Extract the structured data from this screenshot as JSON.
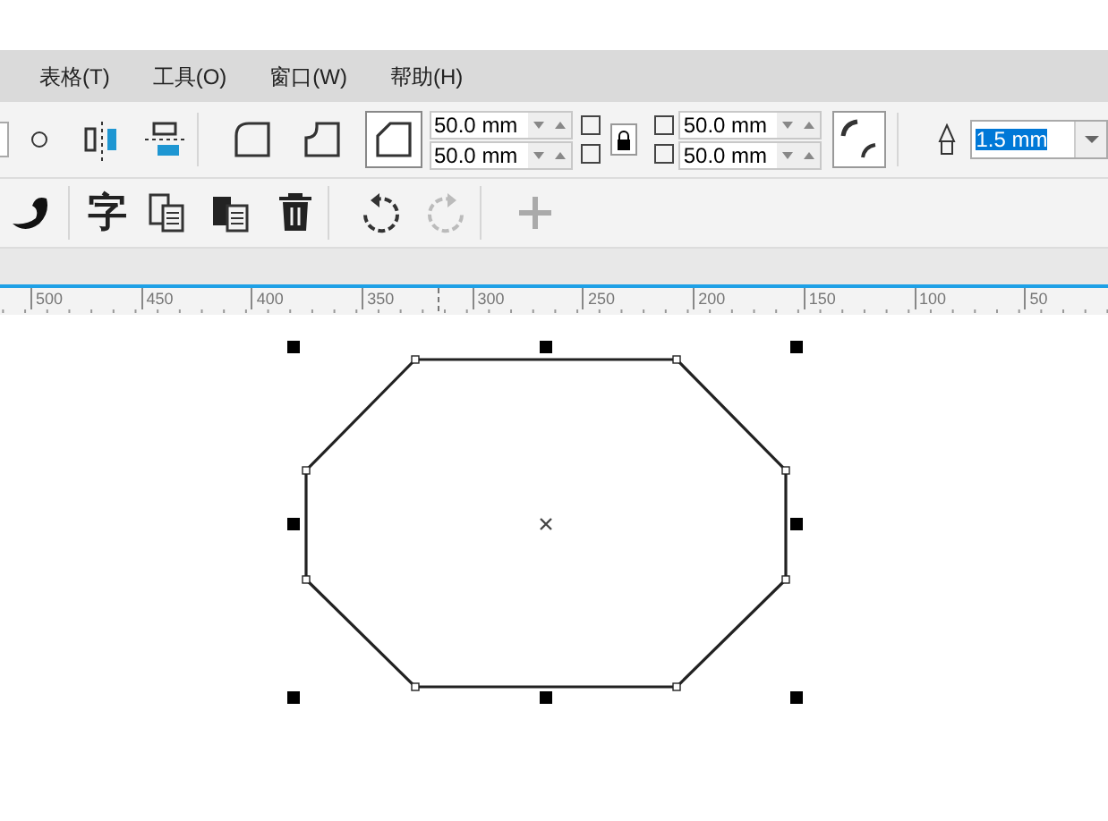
{
  "menu": [
    "表格(T)",
    "工具(O)",
    "窗口(W)",
    "帮助(H)"
  ],
  "corner_buttons": [
    {
      "kind": "round",
      "selected": false
    },
    {
      "kind": "scallop",
      "selected": false
    },
    {
      "kind": "chamfer",
      "selected": true
    }
  ],
  "corner_fields_left": [
    "50.0 mm",
    "50.0 mm"
  ],
  "corner_fields_right": [
    "50.0 mm",
    "50.0 mm"
  ],
  "outline_width": {
    "value": "1.5 mm",
    "highlighted": true
  },
  "text_tool_label": "字",
  "ruler_labels": [
    "500",
    "450",
    "400",
    "350",
    "300",
    "250",
    "200",
    "150",
    "100",
    "50"
  ]
}
